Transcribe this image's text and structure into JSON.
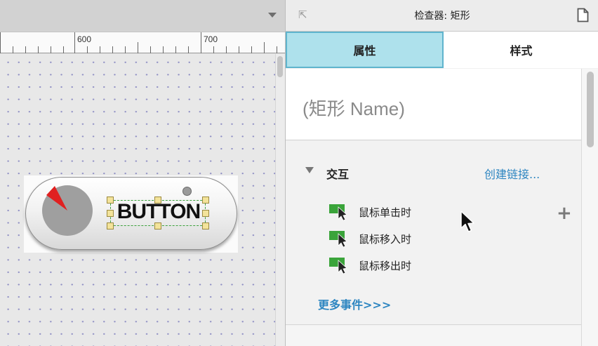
{
  "canvas": {
    "ruler": {
      "labels": [
        "600",
        "700"
      ]
    },
    "widget": {
      "text": "BUTTON",
      "pie_colors": {
        "slice": "#e02020",
        "body": "#9f9f9f"
      }
    }
  },
  "inspector": {
    "title": "检查器: 矩形",
    "tabs": [
      {
        "label": "属性",
        "active": true
      },
      {
        "label": "样式",
        "active": false
      }
    ],
    "name_field": "(矩形 Name)",
    "interaction": {
      "title": "交互",
      "create_link": "创建链接...",
      "events": [
        {
          "label": "鼠标单击时"
        },
        {
          "label": "鼠标移入时"
        },
        {
          "label": "鼠标移出时"
        }
      ],
      "add_symbol": "+",
      "more_events": "更多事件>>>"
    }
  },
  "colors": {
    "tab_active_bg": "#aee1ec",
    "tab_active_border": "#5fb4cd",
    "link": "#2e86c1",
    "event_icon": "#3aa43a",
    "selection": "#3ca13c"
  }
}
